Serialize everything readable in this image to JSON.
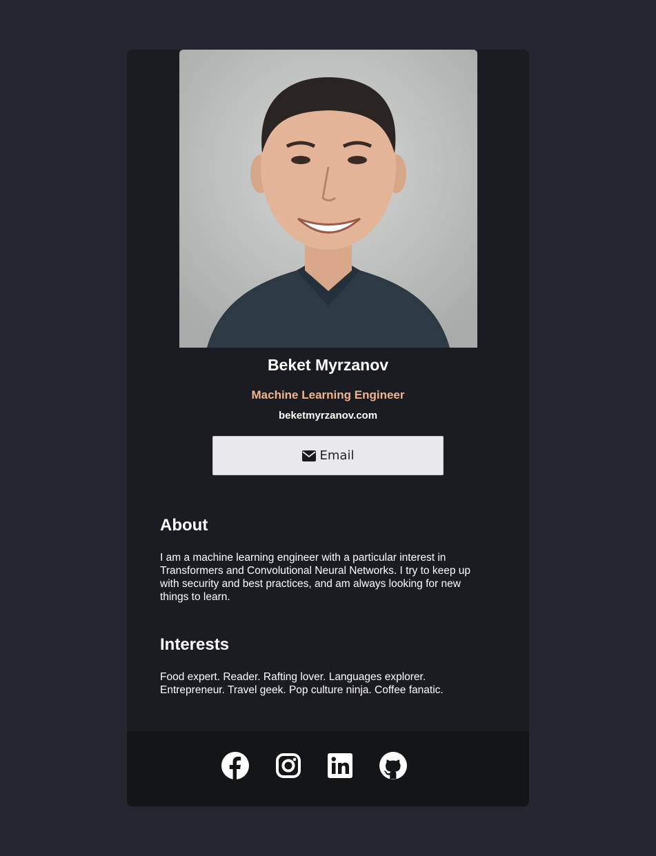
{
  "profile": {
    "name": "Beket Myrzanov",
    "role": "Machine Learning Engineer",
    "website": "beketmyrzanov.com",
    "photo_alt": "Beket Myrzanov"
  },
  "contact": {
    "email_label": "Email",
    "email_icon": "envelope-icon"
  },
  "about": {
    "title": "About",
    "text": "I am a machine learning engineer with a particular interest in Transformers and Convolutional Neural Networks. I try to keep up with security and best practices, and am always looking for new things to learn."
  },
  "interests": {
    "title": "Interests",
    "text": "Food expert. Reader. Rafting lover. Languages explorer. Entrepreneur. Travel geek. Pop culture ninja. Coffee fanatic."
  },
  "social": [
    {
      "icon": "facebook-icon"
    },
    {
      "icon": "instagram-icon"
    },
    {
      "icon": "linkedin-icon"
    },
    {
      "icon": "github-icon"
    }
  ],
  "colors": {
    "page_background": "#23252f",
    "card_background": "#1b1c21",
    "footer_background": "#141517",
    "accent": "#f1b48e",
    "button_background": "#e9e8ed"
  }
}
